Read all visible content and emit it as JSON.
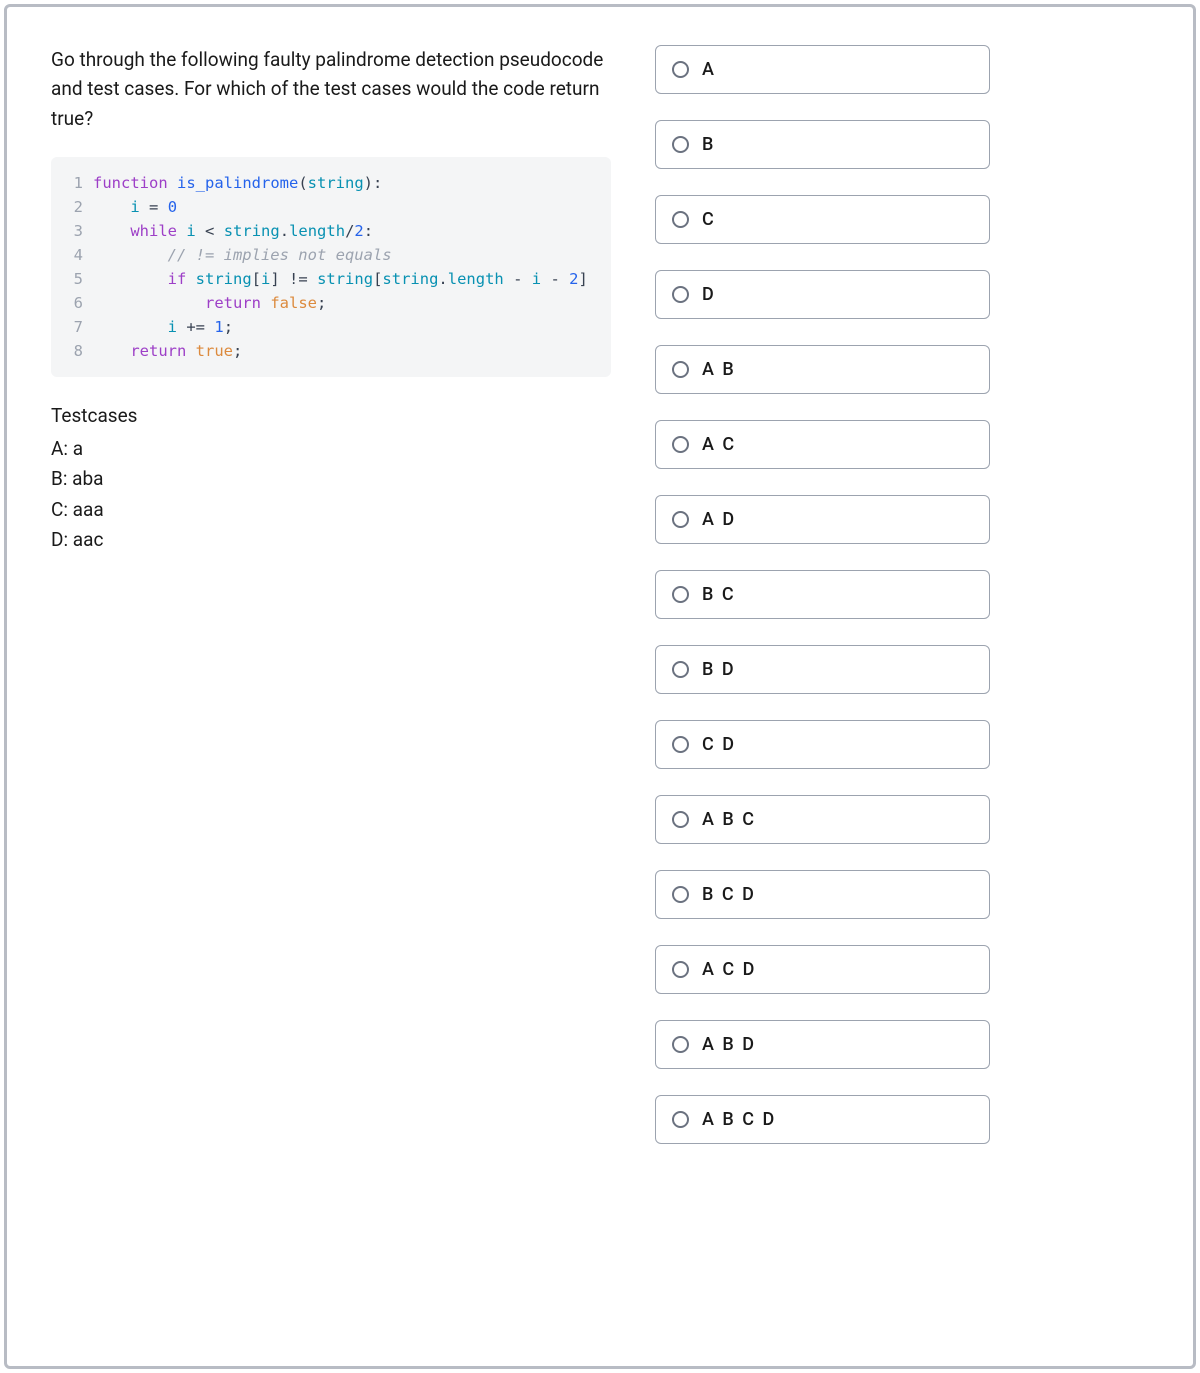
{
  "question": "Go through the following faulty palindrome detection pseudocode and test cases. For which of the test cases would the code return true?",
  "code": {
    "lines": [
      {
        "num": "1",
        "html": "<span class='tok-kw'>function</span> <span class='tok-fn'>is_palindrome</span><span class='tok-punc'>(</span><span class='tok-param'>string</span><span class='tok-punc'>):</span>"
      },
      {
        "num": "2",
        "html": "    <span class='tok-var'>i</span> <span class='tok-op'>=</span> <span class='tok-num'>0</span>"
      },
      {
        "num": "3",
        "html": "    <span class='tok-kw'>while</span> <span class='tok-var'>i</span> <span class='tok-op'>&lt;</span> <span class='tok-var'>string</span><span class='tok-punc'>.</span><span class='tok-prop'>length</span><span class='tok-op'>/</span><span class='tok-num'>2</span><span class='tok-punc'>:</span>"
      },
      {
        "num": "4",
        "html": "        <span class='tok-comment'>// != implies not equals</span>"
      },
      {
        "num": "5",
        "html": "        <span class='tok-kw'>if</span> <span class='tok-var'>string</span><span class='tok-punc'>[</span><span class='tok-var'>i</span><span class='tok-punc'>]</span> <span class='tok-op'>!=</span> <span class='tok-var'>string</span><span class='tok-punc'>[</span><span class='tok-var'>string</span><span class='tok-punc'>.</span><span class='tok-prop'>length</span> <span class='tok-op'>-</span> <span class='tok-var'>i</span> <span class='tok-op'>-</span> <span class='tok-num'>2</span><span class='tok-punc'>]</span>"
      },
      {
        "num": "6",
        "html": "            <span class='tok-kw'>return</span> <span class='tok-bool'>false</span><span class='tok-punc'>;</span>"
      },
      {
        "num": "7",
        "html": "        <span class='tok-var'>i</span> <span class='tok-op'>+=</span> <span class='tok-num'>1</span><span class='tok-punc'>;</span>"
      },
      {
        "num": "8",
        "html": "    <span class='tok-kw'>return</span> <span class='tok-bool'>true</span><span class='tok-punc'>;</span>"
      }
    ]
  },
  "testcases": {
    "title": "Testcases",
    "items": [
      "A: a",
      "B: aba",
      "C: aaa",
      "D: aac"
    ]
  },
  "options": [
    {
      "label": "A"
    },
    {
      "label": "B"
    },
    {
      "label": "C"
    },
    {
      "label": "D"
    },
    {
      "label": "A B"
    },
    {
      "label": "A C"
    },
    {
      "label": "A D"
    },
    {
      "label": "B C"
    },
    {
      "label": "B D"
    },
    {
      "label": "C D"
    },
    {
      "label": "A B C"
    },
    {
      "label": "B C D"
    },
    {
      "label": "A C D"
    },
    {
      "label": "A B D"
    },
    {
      "label": "A B C D"
    }
  ]
}
